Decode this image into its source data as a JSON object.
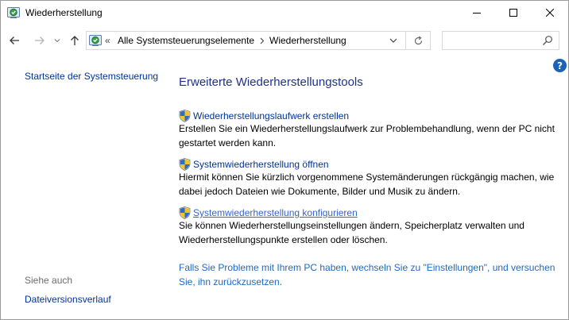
{
  "window": {
    "title": "Wiederherstellung"
  },
  "address_bar": {
    "overflow_chevron": "«",
    "crumbs": [
      "Alle Systemsteuerungselemente",
      "Wiederherstellung"
    ]
  },
  "search": {
    "placeholder": ""
  },
  "help": {
    "label": "?"
  },
  "sidebar": {
    "home_link": "Startseite der Systemsteuerung",
    "see_also_label": "Siehe auch",
    "see_also_items": [
      "Dateiversionsverlauf"
    ]
  },
  "main": {
    "heading": "Erweiterte Wiederherstellungstools",
    "tasks": [
      {
        "link": "Wiederherstellungslaufwerk erstellen",
        "description": "Erstellen Sie ein Wiederherstellungslaufwerk zur Problembehandlung, wenn der PC nicht gestartet werden kann."
      },
      {
        "link": "Systemwiederherstellung öffnen",
        "description": "Hiermit können Sie kürzlich vorgenommene Systemänderungen rückgängig machen, wie dabei jedoch Dateien wie Dokumente, Bilder und Musik zu ändern."
      },
      {
        "link": "Systemwiederherstellung konfigurieren",
        "description": "Sie können Wiederherstellungseinstellungen ändern, Speicherplatz verwalten und Wiederherstellungspunkte erstellen oder löschen."
      }
    ],
    "settings_hint": "Falls Sie Probleme mit Ihrem PC haben, wechseln Sie zu \"Einstellungen\", und versuchen Sie, ihn zurückzusetzen."
  },
  "colors": {
    "link": "#003399",
    "heading": "#1e3287",
    "hint_link": "#1b6ac9",
    "help_badge": "#1b63b8"
  }
}
